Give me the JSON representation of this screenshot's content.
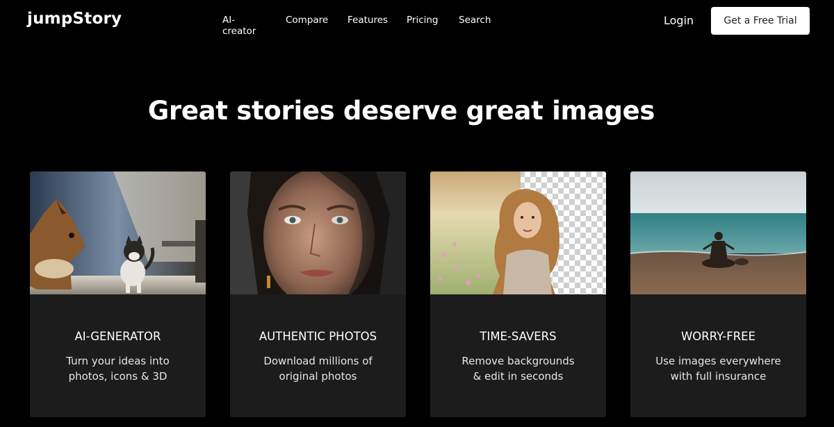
{
  "header": {
    "logo": "jumpStory",
    "nav": [
      "AI-creator",
      "Compare",
      "Features",
      "Pricing",
      "Search"
    ],
    "login_label": "Login",
    "trial_label": "Get a Free Trial"
  },
  "hero": {
    "title": "Great stories deserve great images"
  },
  "cards": [
    {
      "title": "AI-GENERATOR",
      "desc_line1": "Turn your ideas into",
      "desc_line2": "photos, icons & 3D"
    },
    {
      "title": "AUTHENTIC PHOTOS",
      "desc_line1": "Download millions of",
      "desc_line2": "original photos"
    },
    {
      "title": "TIME-SAVERS",
      "desc_line1": "Remove backgrounds",
      "desc_line2": "& edit in seconds"
    },
    {
      "title": "WORRY-FREE",
      "desc_line1": "Use images everywhere",
      "desc_line2": "with full insurance"
    }
  ],
  "colors": {
    "background": "#000000",
    "card_background": "#1c1c1c",
    "button_background": "#ffffff",
    "button_text": "#222222"
  }
}
